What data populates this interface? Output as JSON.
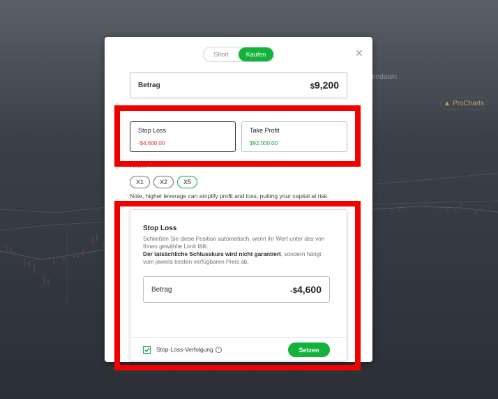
{
  "background": {
    "fragment_text": "endaten",
    "prochart_label": "ProCharts"
  },
  "modal": {
    "toggle": {
      "short_label": "Short",
      "buy_label": "Kaufen",
      "selected": "Kaufen"
    },
    "close_icon": "close-icon",
    "amount": {
      "label": "Betrag",
      "currency": "$",
      "value": "9,200"
    },
    "stop_loss_tile": {
      "title": "Stop Loss",
      "value": "-$4,600.00"
    },
    "take_profit_tile": {
      "title": "Take Profit",
      "value": "$92,000.00"
    },
    "leverage": {
      "label": "Hebel",
      "options": [
        "X1",
        "X2",
        "X5"
      ],
      "selected": "X5",
      "note": "Note, higher leverage can amplify profit and loss, putting your capital at risk."
    },
    "stop_loss_panel": {
      "title": "Stop Loss",
      "description_1": "Schließen Sie diese Position automatisch, wenn ihr Wert unter das von Ihnen gewählte Limit fällt.",
      "description_bold": "Der tatsächliche Schlusskurs wird nicht garantiert",
      "description_2": ", sondern hängt vom jeweils besten verfügbaren Preis ab.",
      "amount_label": "Betrag",
      "amount_prefix": "-$",
      "amount_value": "4,600",
      "trailing_label": "Stop-Loss-Verfolgung",
      "trailing_checked": true,
      "set_button": "Setzen"
    }
  },
  "colors": {
    "accent_green": "#13b23a",
    "loss_red": "#e0302a",
    "highlight_red": "#f20000"
  }
}
